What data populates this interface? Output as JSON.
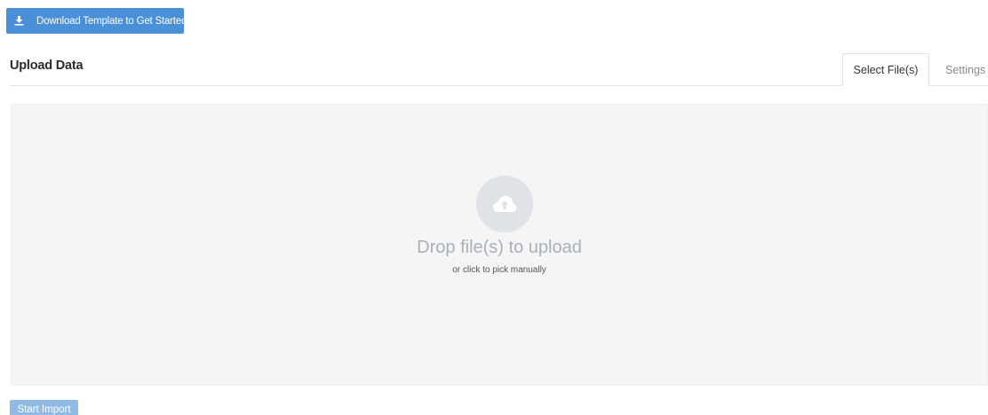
{
  "toolbar": {
    "download_label": "Download Template to Get Started",
    "download_icon": "download-icon"
  },
  "header": {
    "title": "Upload Data"
  },
  "tabs": [
    {
      "label": "Select File(s)",
      "active": true
    },
    {
      "label": "Settings",
      "active": false
    }
  ],
  "dropzone": {
    "icon": "cloud-upload-icon",
    "title": "Drop file(s) to upload",
    "subtitle": "or click to pick manually"
  },
  "footer": {
    "start_label": "Start Import"
  },
  "colors": {
    "primary": "#4a90d9",
    "primary_disabled": "#8fbbe6",
    "dropzone_bg": "#f5f5f5",
    "icon_circle": "#dfe2e6",
    "drop_text": "#a9b0ba"
  }
}
